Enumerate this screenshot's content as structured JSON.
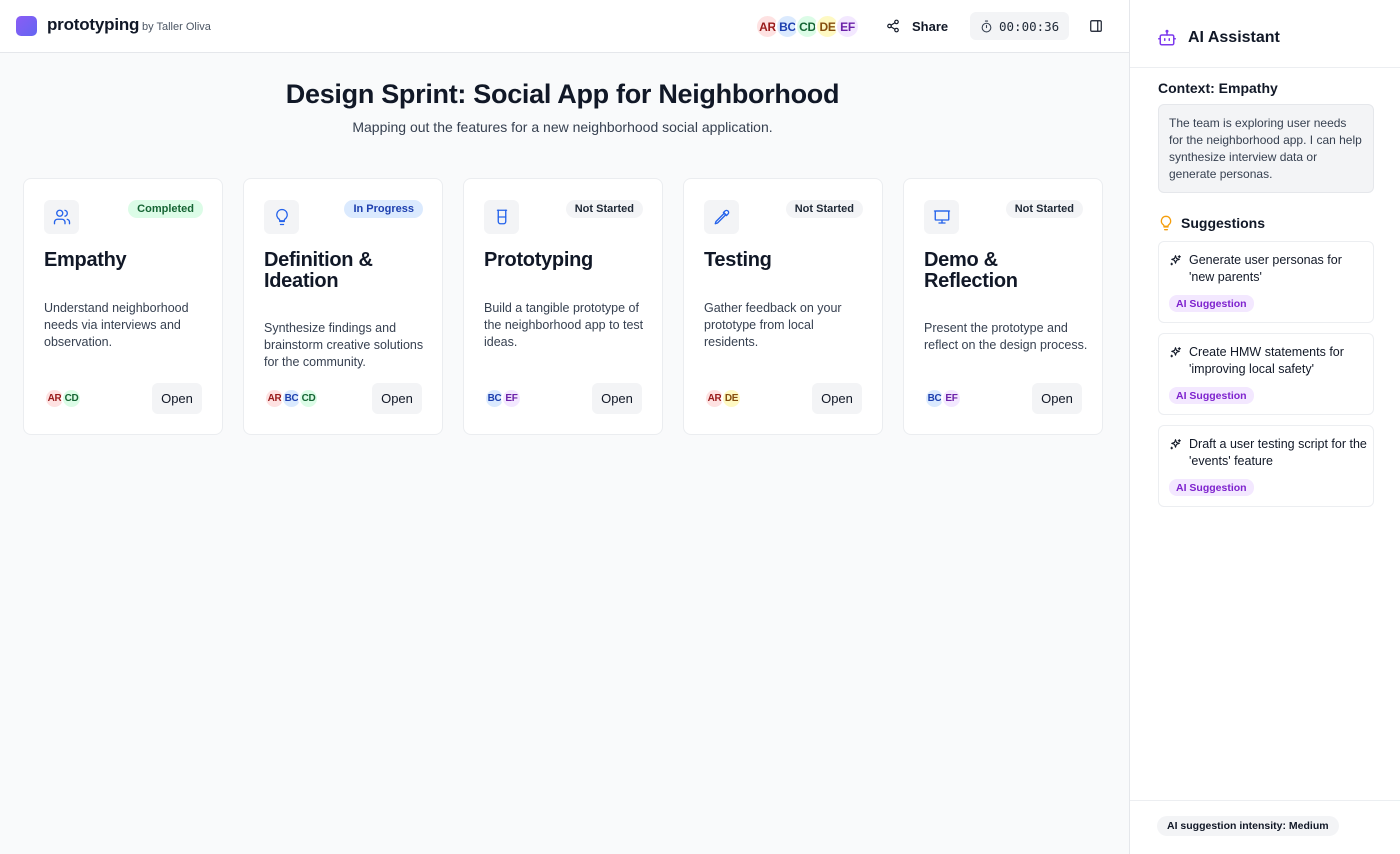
{
  "app": {
    "title": "prototyping",
    "by": "by Taller Oliva"
  },
  "header": {
    "collaborators": [
      {
        "initials": "AR",
        "bg": "#fee2e2",
        "fg": "#991b1b"
      },
      {
        "initials": "BC",
        "bg": "#dbeafe",
        "fg": "#1e40af"
      },
      {
        "initials": "CD",
        "bg": "#dcfce7",
        "fg": "#166534"
      },
      {
        "initials": "DE",
        "bg": "#fef9c3",
        "fg": "#854d0e"
      },
      {
        "initials": "EF",
        "bg": "#f3e8ff",
        "fg": "#6b21a8"
      }
    ],
    "share_label": "Share",
    "timer": "00:00:36",
    "share_icon": "share-icon",
    "timer_icon": "stopwatch-icon",
    "panel_icon": "panel-toggle-icon"
  },
  "main": {
    "title": "Design Sprint: Social App for Neighborhood",
    "subtitle": "Mapping out the features for a new neighborhood social application."
  },
  "phases": [
    {
      "title": "Empathy",
      "status": "Completed",
      "icon": "users-icon",
      "description": "Understand neighborhood needs via interviews and observation.",
      "people": [
        "AR",
        "CD"
      ],
      "open_label": "Open"
    },
    {
      "title": "Definition & Ideation",
      "status": "In Progress",
      "icon": "lightbulb-icon",
      "description": "Synthesize findings and brainstorm creative solutions for the community.",
      "people": [
        "AR",
        "BC",
        "CD"
      ],
      "open_label": "Open"
    },
    {
      "title": "Prototyping",
      "status": "Not Started",
      "icon": "beaker-icon",
      "description": "Build a tangible prototype of the neighborhood app to test ideas.",
      "people": [
        "BC",
        "EF"
      ],
      "open_label": "Open"
    },
    {
      "title": "Testing",
      "status": "Not Started",
      "icon": "pipette-icon",
      "description": "Gather feedback on your prototype from local residents.",
      "people": [
        "AR",
        "DE"
      ],
      "open_label": "Open"
    },
    {
      "title": "Demo & Reflection",
      "status": "Not Started",
      "icon": "presentation-icon",
      "description": "Present the prototype and reflect on the design process.",
      "people": [
        "BC",
        "EF"
      ],
      "open_label": "Open"
    }
  ],
  "assistant": {
    "title": "AI Assistant",
    "icon": "bot-icon",
    "context_title": "Context: Empathy",
    "context_text": "The team is exploring user needs for the neighborhood app. I can help synthesize interview data or generate personas.",
    "suggestions_title": "Suggestions",
    "suggestions": [
      {
        "text": "Generate user personas for 'new parents'",
        "tag": "AI Suggestion"
      },
      {
        "text": "Create HMW statements for 'improving local safety'",
        "tag": "AI Suggestion"
      },
      {
        "text": "Draft a user testing script for the 'events' feature",
        "tag": "AI Suggestion"
      }
    ],
    "intensity": "AI suggestion intensity: Medium"
  },
  "colors": {
    "accent": "#6366f1",
    "suggestion_tag": "#7e22ce",
    "lightbulb": "#f59e0b"
  }
}
